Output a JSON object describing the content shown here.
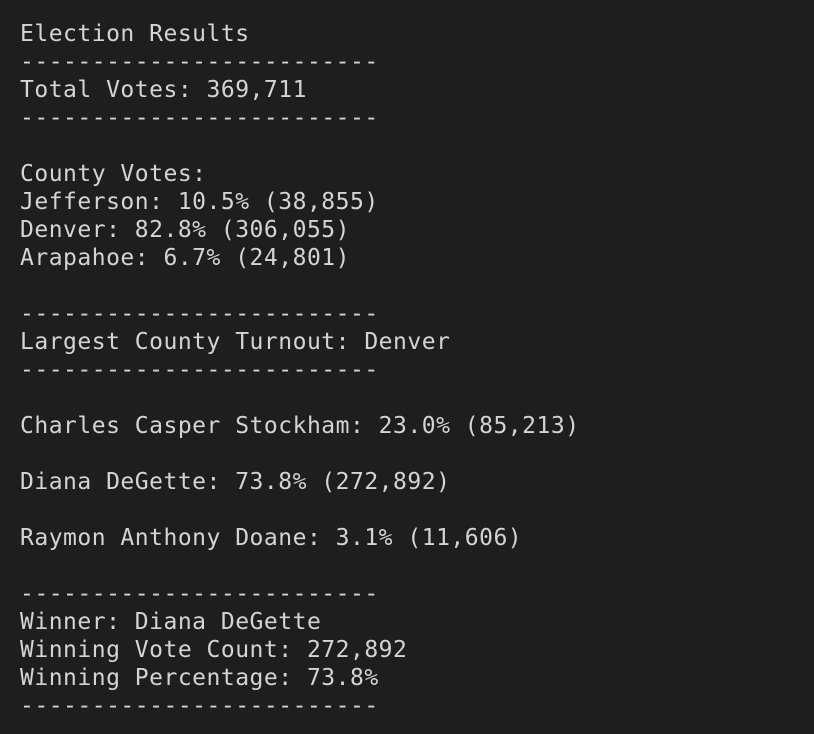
{
  "report": {
    "title": "Election Results",
    "separator": "-------------------------",
    "total_votes": "Total Votes: 369,711",
    "county_header": "County Votes:",
    "counties": [
      "Jefferson: 10.5% (38,855)",
      "Denver: 82.8% (306,055)",
      "Arapahoe: 6.7% (24,801)"
    ],
    "largest_county": "Largest County Turnout: Denver",
    "candidates": [
      "Charles Casper Stockham: 23.0% (85,213)",
      "Diana DeGette: 73.8% (272,892)",
      "Raymon Anthony Doane: 3.1% (11,606)"
    ],
    "winner": "Winner: Diana DeGette",
    "winning_vote_count": "Winning Vote Count: 272,892",
    "winning_percentage": "Winning Percentage: 73.8%"
  }
}
